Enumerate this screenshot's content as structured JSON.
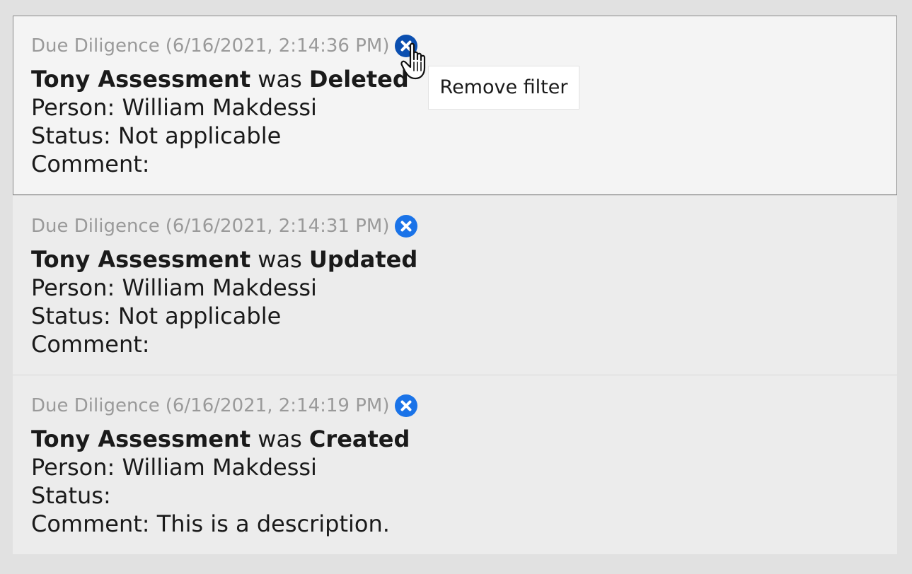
{
  "entries": [
    {
      "category": "Due Diligence",
      "timestamp": "(6/16/2021, 2:14:36 PM)",
      "remove_icon": "remove-filter-icon",
      "subject": "Tony Assessment",
      "connector": "was",
      "action": "Deleted",
      "person_label": "Person:",
      "person_value": "William Makdessi",
      "status_label": "Status:",
      "status_value": "Not applicable",
      "comment_label": "Comment:",
      "comment_value": ""
    },
    {
      "category": "Due Diligence",
      "timestamp": "(6/16/2021, 2:14:31 PM)",
      "remove_icon": "remove-filter-icon",
      "subject": "Tony Assessment",
      "connector": "was",
      "action": "Updated",
      "person_label": "Person:",
      "person_value": "William Makdessi",
      "status_label": "Status:",
      "status_value": "Not applicable",
      "comment_label": "Comment:",
      "comment_value": ""
    },
    {
      "category": "Due Diligence",
      "timestamp": "(6/16/2021, 2:14:19 PM)",
      "remove_icon": "remove-filter-icon",
      "subject": "Tony Assessment",
      "connector": "was",
      "action": "Created",
      "person_label": "Person:",
      "person_value": "William Makdessi",
      "status_label": "Status:",
      "status_value": "",
      "comment_label": "Comment:",
      "comment_value": "This is a description."
    }
  ],
  "tooltip": {
    "text": "Remove filter"
  },
  "colors": {
    "remove_icon": "#1a73e8",
    "remove_icon_hover": "#0b4fb0"
  }
}
